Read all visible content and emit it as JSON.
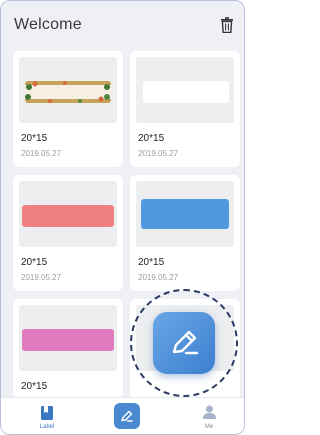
{
  "header": {
    "title": "Welcome"
  },
  "cards": [
    {
      "size": "20*15",
      "date": "2019.05.27",
      "bar_color": "#f4efe2",
      "bar_style": "floral"
    },
    {
      "size": "20*15",
      "date": "2019.05.27",
      "bar_color": "#ffffff",
      "bar_style": "plain"
    },
    {
      "size": "20*15",
      "date": "2019.05.27",
      "bar_color": "#f08080",
      "bar_style": "solid"
    },
    {
      "size": "20*15",
      "date": "2019.05.27",
      "bar_color": "#4f9ade",
      "bar_style": "solid"
    },
    {
      "size": "20*15",
      "date": "",
      "bar_color": "#df7bbf",
      "bar_style": "solid"
    },
    {
      "size": "",
      "date": "",
      "bar_color": "",
      "bar_style": "hidden"
    }
  ],
  "tabs": [
    {
      "label": "Label",
      "icon": "bookmark-icon",
      "active": true
    },
    {
      "label": "",
      "icon": "edit-icon",
      "active": false
    },
    {
      "label": "Me",
      "icon": "user-icon",
      "active": false
    }
  ],
  "colors": {
    "accent": "#3b78c4",
    "fab": "#4a88d0",
    "background": "#eef0f6"
  }
}
